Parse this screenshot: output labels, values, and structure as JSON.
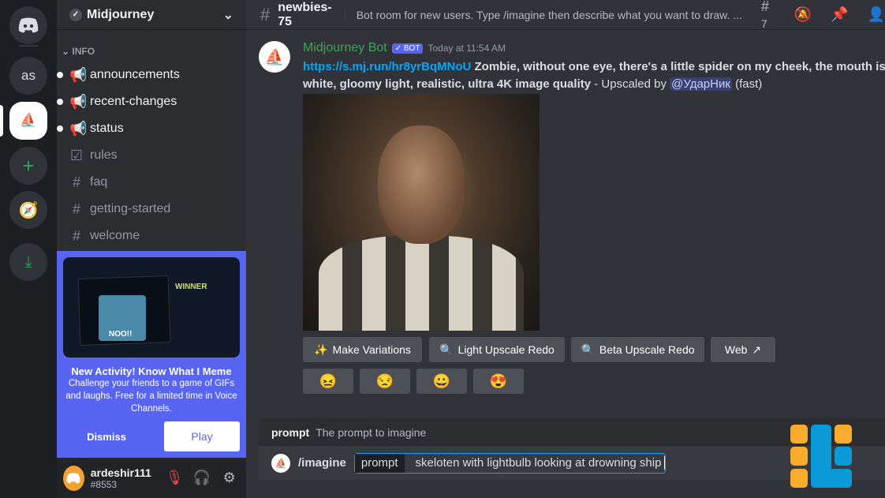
{
  "server_rail": {
    "items": [
      {
        "name": "Discord home"
      },
      {
        "label": "as"
      },
      {
        "name": "Midjourney"
      },
      {
        "name": "Add a Server"
      },
      {
        "name": "Explore"
      },
      {
        "name": "Download"
      }
    ]
  },
  "server": {
    "name": "Midjourney",
    "category": "INFO",
    "channels": [
      {
        "label": "announcements",
        "icon": "megaphone",
        "unread": true
      },
      {
        "label": "recent-changes",
        "icon": "megaphone",
        "unread": true
      },
      {
        "label": "status",
        "icon": "megaphone",
        "unread": true
      },
      {
        "label": "rules",
        "icon": "checkbox"
      },
      {
        "label": "faq",
        "icon": "hash"
      },
      {
        "label": "getting-started",
        "icon": "hash"
      },
      {
        "label": "welcome",
        "icon": "hash"
      }
    ]
  },
  "promo": {
    "title": "New Activity! Know What I Meme",
    "body": "Challenge your friends to a game of GIFs and laughs. Free for a limited time in Voice Channels.",
    "dismiss": "Dismiss",
    "play": "Play",
    "image_text": {
      "winner": "WINNER",
      "noo": "NOO!!"
    }
  },
  "user": {
    "name": "ardeshir111",
    "tag": "#8553"
  },
  "header": {
    "channel": "newbies-75",
    "topic": "Bot room for new users. Type /imagine then describe what you want to draw. ...",
    "threads_count": "7"
  },
  "message": {
    "author": "Midjourney Bot",
    "badge": "✓ BOT",
    "timestamp": "Today at 11:54 AM",
    "link": "https://s.mj.run/hr8yrBqMNoU",
    "prompt_line1": " Zombie, without one eye, there's a little spider on my cheek, the mouth is",
    "prompt_line2": "white, gloomy light, realistic, ultra 4K image quality",
    "suffix": " - Upscaled by ",
    "mention": "@УдарНик",
    "speed": " (fast)",
    "buttons": [
      {
        "icon": "✨",
        "label": "Make Variations"
      },
      {
        "icon": "🔍",
        "label": "Light Upscale Redo"
      },
      {
        "icon": "🔍",
        "label": "Beta Upscale Redo"
      },
      {
        "icon": "↗",
        "label": "Web"
      }
    ],
    "reactions": [
      "😖",
      "😒",
      "😀",
      "😍"
    ]
  },
  "autocomplete": {
    "option": "prompt",
    "description": "The prompt to imagine"
  },
  "input": {
    "command": "/imagine",
    "option": "prompt",
    "value": "skeloten with lightbulb looking at drowning ship"
  },
  "colors": {
    "accent": "#5865f2",
    "bot_name": "#3ba55c",
    "link": "#00a8fc",
    "logo_orange": "#f9ab2d",
    "logo_blue": "#0a9ad7"
  }
}
